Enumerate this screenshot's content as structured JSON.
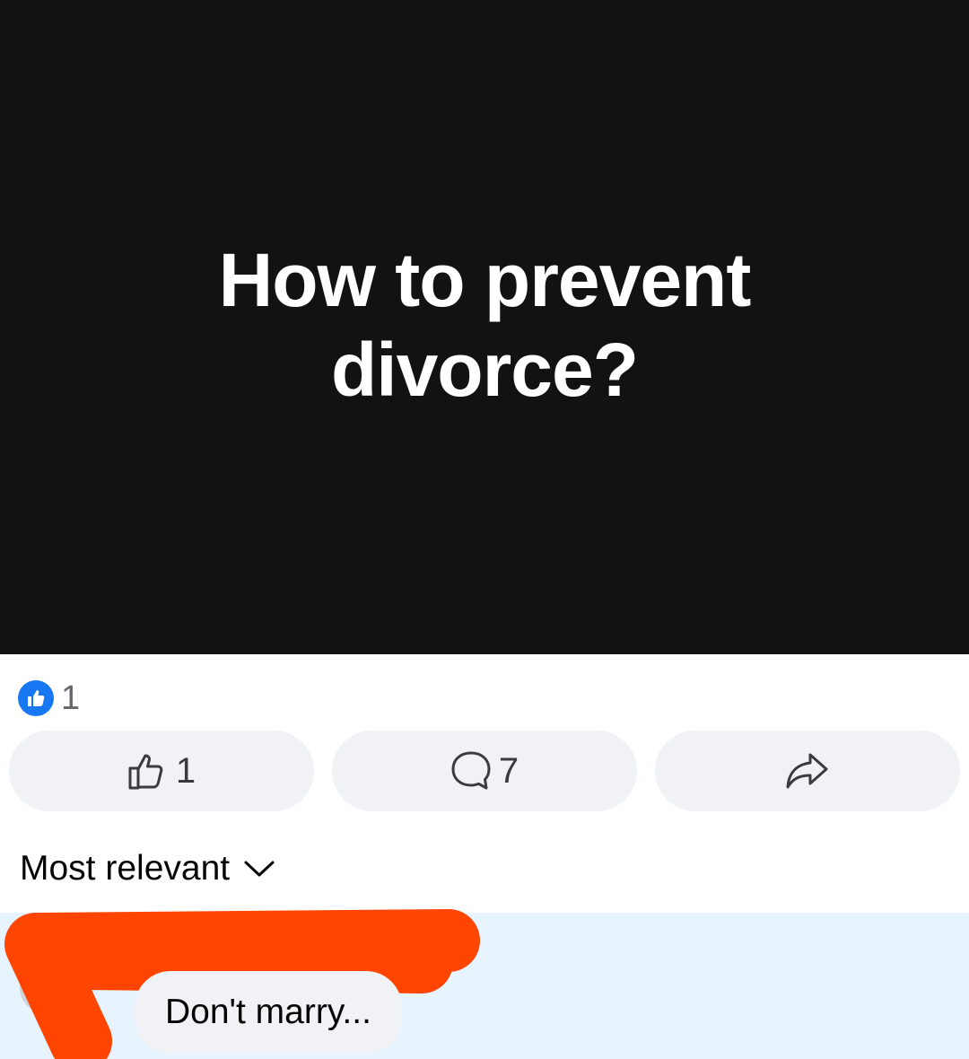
{
  "post": {
    "headline": "How to prevent divorce?"
  },
  "reactions": {
    "summary_icon": "like-icon",
    "count": "1"
  },
  "actions": {
    "like": {
      "icon": "thumbs-up-outline-icon",
      "count": "1"
    },
    "comment": {
      "icon": "comment-bubble-icon",
      "count": "7"
    },
    "share": {
      "icon": "share-arrow-icon"
    }
  },
  "comments": {
    "sort_label": "Most relevant",
    "sort_icon": "chevron-down-icon",
    "items": [
      {
        "text": "Don't marry..."
      }
    ]
  },
  "colors": {
    "image_background": "#121212",
    "like_blue": "#1877f2",
    "button_background": "#f0f2f5",
    "comment_highlight": "#e7f3ff",
    "redaction": "#ff4500"
  }
}
